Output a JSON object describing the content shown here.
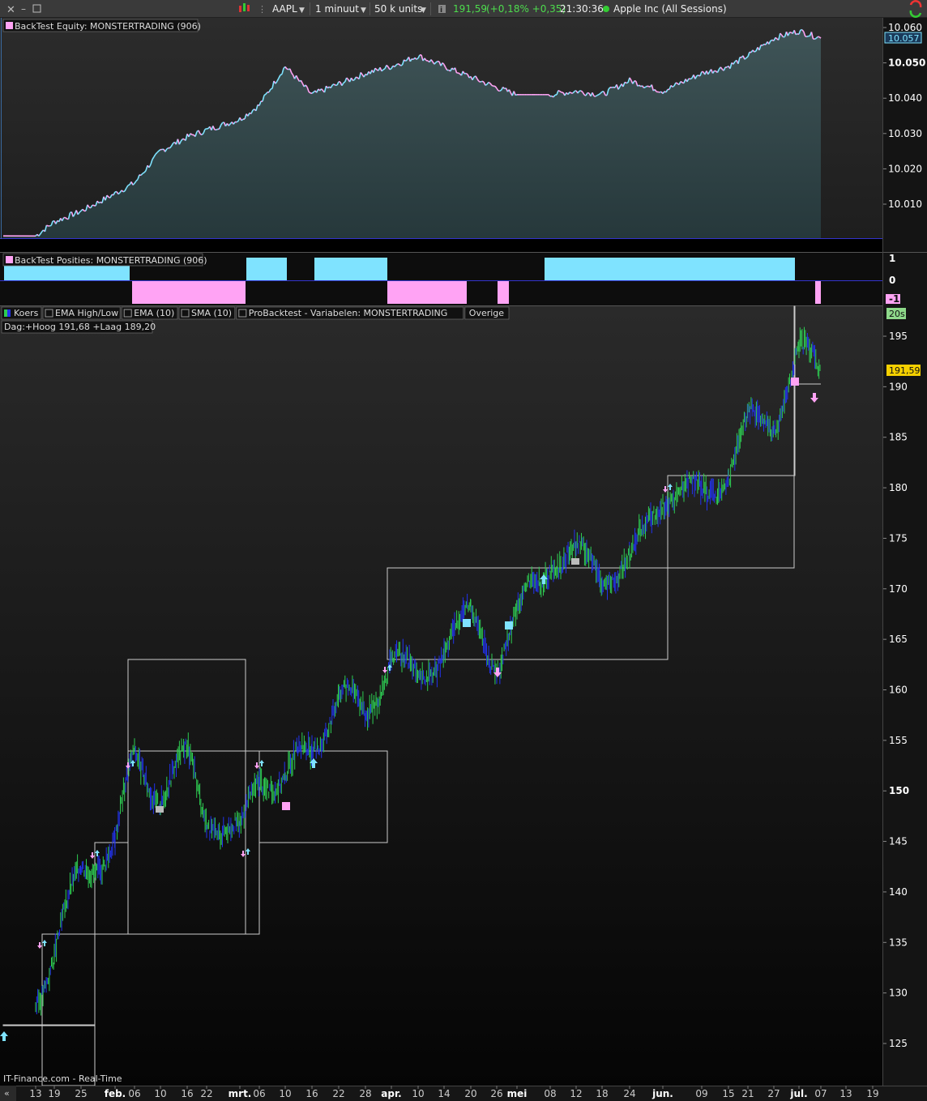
{
  "toolbar": {
    "symbol": "AAPL",
    "timeframe": "1 minuut",
    "units": "50 k units",
    "price": "191,59",
    "change": "(+0,18% +0,35)",
    "time": "21:30:36",
    "instrument": "Apple Inc (All Sessions)"
  },
  "panels": {
    "equity_title": "BackTest Equity: MONSTERTRADING (906)",
    "positions_title": "BackTest Posities: MONSTERTRADING (906)",
    "price_legend": [
      "Koers",
      "EMA High/Low",
      "EMA (10)",
      "SMA (10)",
      "ProBacktest - Variabelen: MONSTERTRADING",
      "Overige"
    ],
    "day_info": "Dag:+Hoog 191,68 +Laag 189,20",
    "interval_badge": "20s",
    "last_price_badge": "191,59",
    "equity_last_badge": "10.057",
    "footer": "IT-Finance.com - Real-Time"
  },
  "colors": {
    "cyan": "#7fe3ff",
    "pink": "#ffa3f4",
    "green_candle": "#2ecc52",
    "blue_candle": "#2233ee",
    "price_badge": "#f5d000",
    "interval_badge": "#8ed98a"
  },
  "chart_data": [
    {
      "type": "area",
      "title": "BackTest Equity: MONSTERTRADING (906)",
      "y_ticks": [
        "10.060",
        "10.050",
        "10.040",
        "10.030",
        "10.020",
        "10.010"
      ],
      "ylim": [
        10000,
        10062
      ],
      "x": [
        "13",
        "19",
        "25",
        "feb.",
        "06",
        "10",
        "16",
        "22",
        "mrt.",
        "06",
        "10",
        "16",
        "22",
        "28",
        "apr.",
        "10",
        "14",
        "20",
        "26",
        "mei",
        "08",
        "12",
        "18",
        "24",
        "jun.",
        "09",
        "15",
        "21",
        "27",
        "jul.",
        "07"
      ],
      "values": [
        10001,
        10005,
        10008,
        10013,
        10016,
        10025,
        10029,
        10031,
        10034,
        10038,
        10049,
        10041,
        10044,
        10047,
        10049,
        10052,
        10049,
        10046,
        10043,
        10041,
        10041,
        10042,
        10041,
        10045,
        10042,
        10047,
        10049,
        10052,
        10057,
        10059,
        10057
      ]
    },
    {
      "type": "bar",
      "title": "BackTest Posities: MONSTERTRADING (906)",
      "y_ticks": [
        "1",
        "0",
        "-1"
      ],
      "segments": [
        {
          "from": "start",
          "to": "feb.",
          "value": 1
        },
        {
          "from": "feb.",
          "to": "mrt. 06",
          "value": -1
        },
        {
          "from": "mrt. 06",
          "to": "mrt. 10",
          "value": 1
        },
        {
          "from": "mrt. 16",
          "to": "apr.",
          "value": 1
        },
        {
          "from": "apr.",
          "to": "apr. 20",
          "value": -1
        },
        {
          "from": "apr. 26",
          "to": "apr. 28",
          "value": -1
        },
        {
          "from": "mei 08",
          "to": "jul.",
          "value": 1
        },
        {
          "from": "jul. 07",
          "to": "jul. 07",
          "value": -1
        }
      ]
    },
    {
      "type": "line",
      "title": "AAPL",
      "y_ticks": [
        "195",
        "190",
        "185",
        "180",
        "175",
        "170",
        "165",
        "160",
        "155",
        "150",
        "145",
        "140",
        "135",
        "130",
        "125"
      ],
      "ylim": [
        122,
        200
      ],
      "x": [
        "13",
        "19",
        "25",
        "feb.",
        "06",
        "10",
        "16",
        "22",
        "mrt.",
        "06",
        "10",
        "16",
        "22",
        "28",
        "apr.",
        "10",
        "14",
        "20",
        "26",
        "mei",
        "08",
        "12",
        "18",
        "24",
        "jun.",
        "09",
        "15",
        "21",
        "27",
        "jul.",
        "07"
      ],
      "values": [
        130,
        134,
        142,
        145,
        153,
        150,
        153,
        148,
        145,
        152,
        151,
        154,
        160,
        157,
        164,
        160,
        165,
        167,
        163,
        167,
        173,
        173,
        172,
        172,
        180,
        179,
        182,
        186,
        187,
        193,
        191.59
      ],
      "last_price": 191.59
    }
  ],
  "x_axis_labels": [
    "13",
    "19",
    "25",
    "feb.",
    "06",
    "10",
    "16",
    "22",
    "mrt.",
    "06",
    "10",
    "16",
    "22",
    "28",
    "apr.",
    "10",
    "14",
    "20",
    "26",
    "mei",
    "08",
    "12",
    "18",
    "24",
    "jun.",
    "09",
    "15",
    "21",
    "27",
    "jul.",
    "07",
    "13",
    "19"
  ]
}
